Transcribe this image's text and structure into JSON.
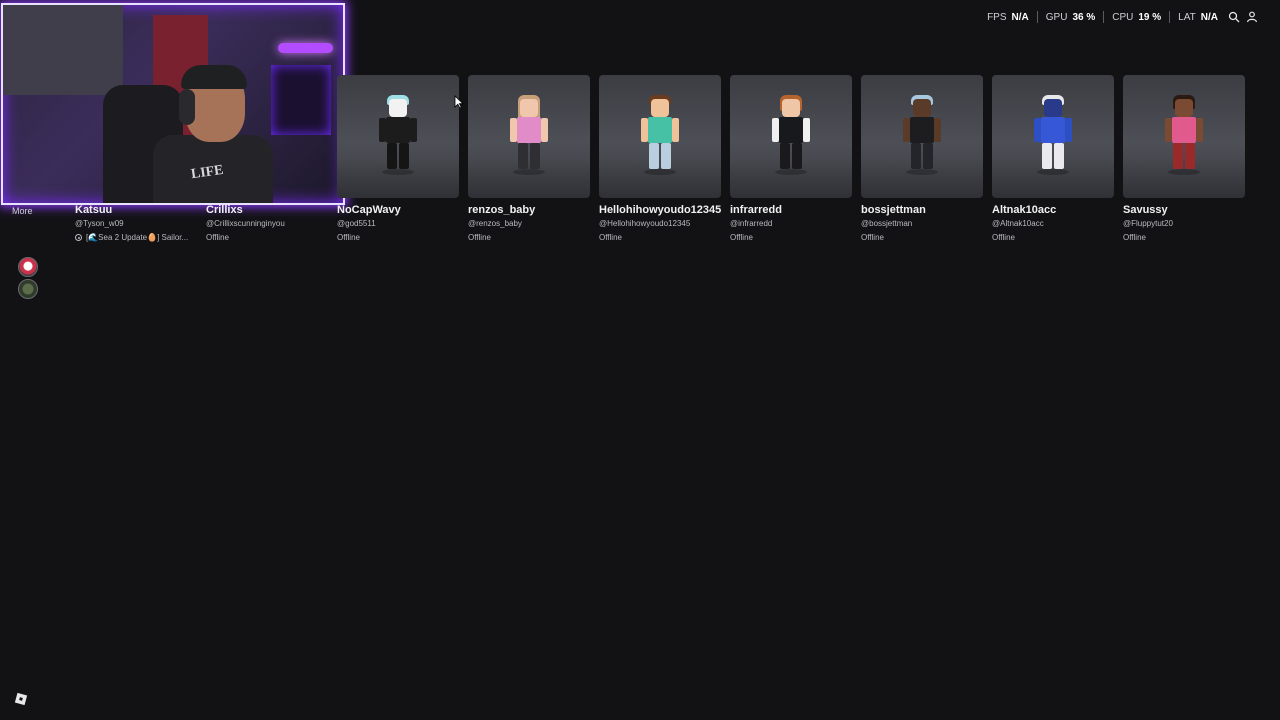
{
  "perf": {
    "fps_label": "FPS",
    "fps_value": "N/A",
    "gpu_label": "GPU",
    "gpu_value": "36 %",
    "cpu_label": "CPU",
    "cpu_value": "19 %",
    "lat_label": "LAT",
    "lat_value": "N/A"
  },
  "sidebar": {
    "more_label": "More"
  },
  "friends": [
    {
      "name": "Katsuu",
      "handle": "@Tyson_w09",
      "status": "[🌊Sea 2 Update🥚] Sailor...",
      "in_game": true
    },
    {
      "name": "Crillixs",
      "handle": "@Crillixscunninginyou",
      "status": "Offline"
    },
    {
      "name": "NoCapWavy",
      "handle": "@god5511",
      "status": "Offline"
    },
    {
      "name": "renzos_baby",
      "handle": "@renzos_baby",
      "status": "Offline"
    },
    {
      "name": "Hellohihowyoudo12345",
      "handle": "@Hellohihowyoudo12345",
      "status": "Offline"
    },
    {
      "name": "infrarredd",
      "handle": "@infrarredd",
      "status": "Offline"
    },
    {
      "name": "bossjettman",
      "handle": "@bossjettman",
      "status": "Offline"
    },
    {
      "name": "Altnak10acc",
      "handle": "@Altnak10acc",
      "status": "Offline"
    },
    {
      "name": "Savussy",
      "handle": "@Fluppytut20",
      "status": "Offline"
    }
  ],
  "webcam": {
    "shirt_text": "LIFE"
  },
  "icons": {
    "perf_search": "search-icon",
    "perf_user": "user-icon",
    "bottom_logo": "roblox-logo-icon"
  },
  "colors": {
    "background": "#121215",
    "webcam_glow": "#8d3cff"
  }
}
